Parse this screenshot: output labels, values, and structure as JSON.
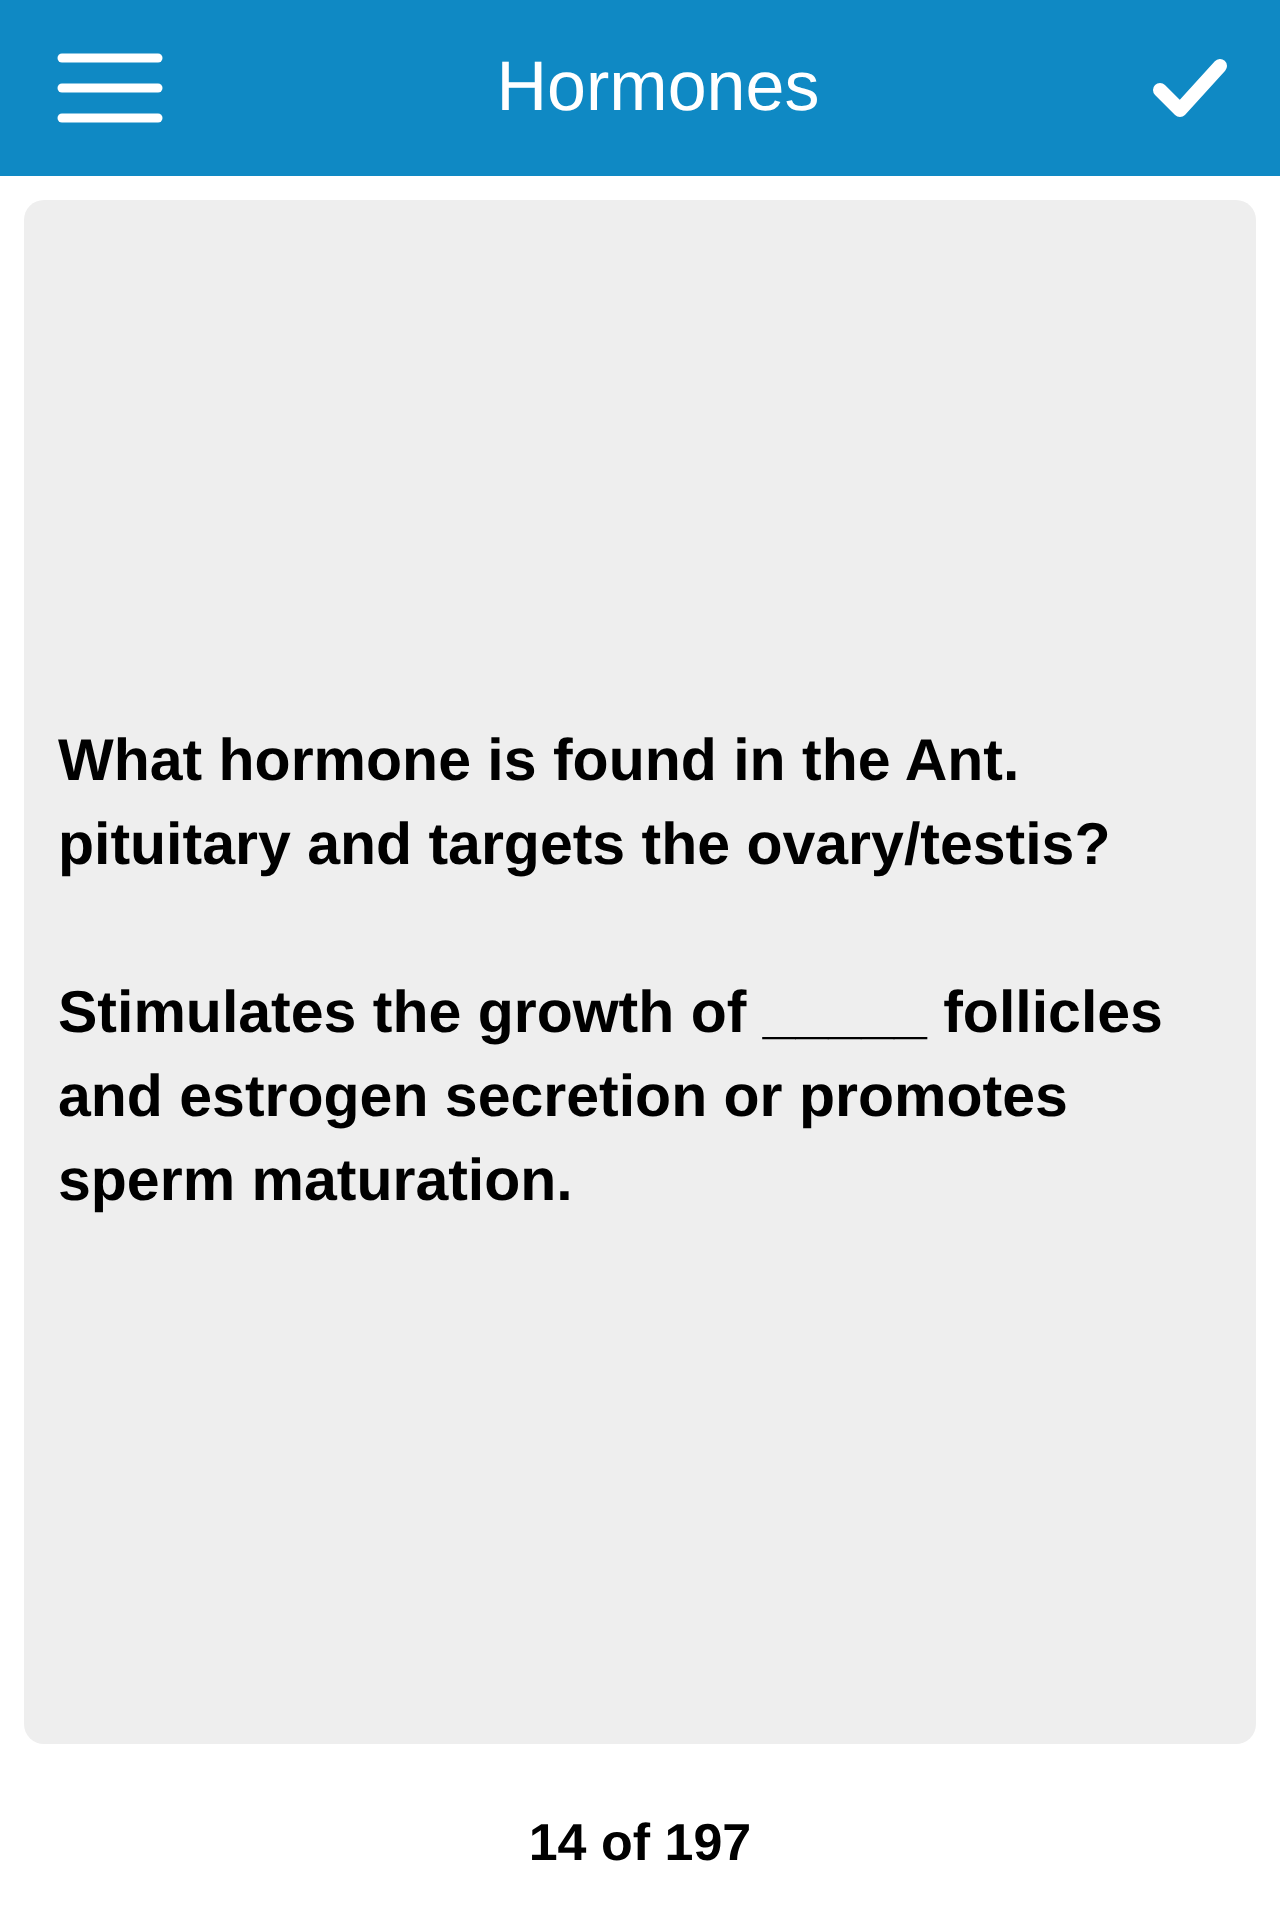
{
  "header": {
    "title": "Hormones"
  },
  "card": {
    "paragraphs": [
      "What hormone is found in the Ant. pituitary and targets the ovary/testis?",
      "Stimulates the growth of _____ follicles and estrogen secretion or promotes sperm maturation."
    ]
  },
  "footer": {
    "counter": "14 of 197"
  }
}
